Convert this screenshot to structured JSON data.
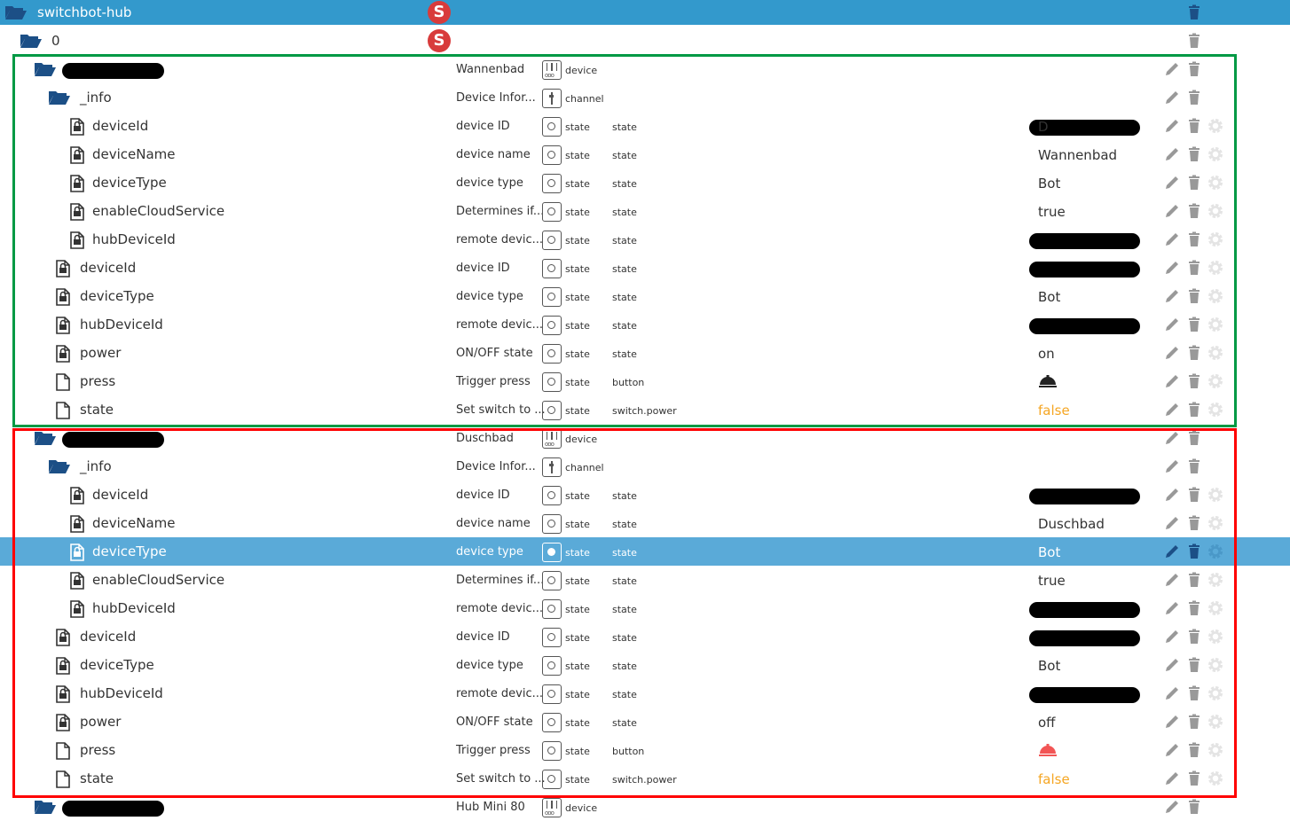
{
  "colors": {
    "header": "#3399cc",
    "selected": "#5aaad8",
    "folder": "#1c4f86",
    "false_value": "#f5a623",
    "green_box": "#009944",
    "red_box": "#ff0000",
    "bell_off": "#f25555"
  },
  "rows": [
    {
      "level": 0,
      "icon": "folder-open-icon",
      "name": "switchbot-hub",
      "header": true,
      "badge": "S",
      "actions": [
        "trash"
      ]
    },
    {
      "level": 1,
      "icon": "folder-open-icon",
      "name": "0",
      "badge": "S",
      "actions": [
        "trash"
      ]
    },
    {
      "level": 2,
      "icon": "folder-open-icon",
      "redacted": true,
      "desc": "Wannenbad",
      "typeIcon": "device-icon",
      "type": "device",
      "actions": [
        "edit",
        "trash"
      ]
    },
    {
      "level": 3,
      "icon": "folder-open-icon",
      "name": "_info",
      "desc": "Device Infor...",
      "typeIcon": "channel-icon",
      "type": "channel",
      "actions": [
        "edit",
        "trash"
      ]
    },
    {
      "level": 4,
      "icon": "file-lock-icon",
      "name": "deviceId",
      "desc": "device ID",
      "typeIcon": "state-icon",
      "type": "state",
      "role": "state",
      "value": "D",
      "valueRedacted": true,
      "actions": [
        "edit",
        "trash",
        "gear"
      ]
    },
    {
      "level": 4,
      "icon": "file-lock-icon",
      "name": "deviceName",
      "desc": "device name",
      "typeIcon": "state-icon",
      "type": "state",
      "role": "state",
      "value": "Wannenbad",
      "actions": [
        "edit",
        "trash",
        "gear"
      ]
    },
    {
      "level": 4,
      "icon": "file-lock-icon",
      "name": "deviceType",
      "desc": "device type",
      "typeIcon": "state-icon",
      "type": "state",
      "role": "state",
      "value": "Bot",
      "actions": [
        "edit",
        "trash",
        "gear"
      ]
    },
    {
      "level": 4,
      "icon": "file-lock-icon",
      "name": "enableCloudService",
      "desc": "Determines if...",
      "typeIcon": "state-icon",
      "type": "state",
      "role": "state",
      "value": "true",
      "actions": [
        "edit",
        "trash",
        "gear"
      ]
    },
    {
      "level": 4,
      "icon": "file-lock-icon",
      "name": "hubDeviceId",
      "desc": "remote devic...",
      "typeIcon": "state-icon",
      "type": "state",
      "role": "state",
      "valueRedacted": true,
      "actions": [
        "edit",
        "trash",
        "gear"
      ]
    },
    {
      "level": 3,
      "icon": "file-lock-icon",
      "name": "deviceId",
      "desc": "device ID",
      "typeIcon": "state-icon",
      "type": "state",
      "role": "state",
      "valueRedacted": true,
      "actions": [
        "edit",
        "trash",
        "gear"
      ]
    },
    {
      "level": 3,
      "icon": "file-lock-icon",
      "name": "deviceType",
      "desc": "device type",
      "typeIcon": "state-icon",
      "type": "state",
      "role": "state",
      "value": "Bot",
      "actions": [
        "edit",
        "trash",
        "gear"
      ]
    },
    {
      "level": 3,
      "icon": "file-lock-icon",
      "name": "hubDeviceId",
      "desc": "remote devic...",
      "typeIcon": "state-icon",
      "type": "state",
      "role": "state",
      "valueRedacted": true,
      "actions": [
        "edit",
        "trash",
        "gear"
      ]
    },
    {
      "level": 3,
      "icon": "file-lock-icon",
      "name": "power",
      "desc": "ON/OFF state",
      "typeIcon": "state-icon",
      "type": "state",
      "role": "state",
      "value": "on",
      "actions": [
        "edit",
        "trash",
        "gear"
      ]
    },
    {
      "level": 3,
      "icon": "file-icon",
      "name": "press",
      "desc": "Trigger press",
      "typeIcon": "state-icon",
      "type": "state",
      "role": "button",
      "valueIcon": "bell-icon",
      "actions": [
        "edit",
        "trash",
        "gear"
      ]
    },
    {
      "level": 3,
      "icon": "file-icon",
      "name": "state",
      "desc": "Set switch to ...",
      "typeIcon": "state-icon",
      "type": "state",
      "role": "switch.power",
      "value": "false",
      "valueFalse": true,
      "actions": [
        "edit",
        "trash",
        "gear"
      ]
    },
    {
      "level": 2,
      "icon": "folder-open-icon",
      "redacted": true,
      "desc": "Duschbad",
      "typeIcon": "device-icon",
      "type": "device",
      "actions": [
        "edit",
        "trash"
      ]
    },
    {
      "level": 3,
      "icon": "folder-open-icon",
      "name": "_info",
      "desc": "Device Infor...",
      "typeIcon": "channel-icon",
      "type": "channel",
      "actions": [
        "edit",
        "trash"
      ]
    },
    {
      "level": 4,
      "icon": "file-lock-icon",
      "name": "deviceId",
      "desc": "device ID",
      "typeIcon": "state-icon",
      "type": "state",
      "role": "state",
      "valueRedacted": true,
      "actions": [
        "edit",
        "trash",
        "gear"
      ]
    },
    {
      "level": 4,
      "icon": "file-lock-icon",
      "name": "deviceName",
      "desc": "device name",
      "typeIcon": "state-icon",
      "type": "state",
      "role": "state",
      "value": "Duschbad",
      "actions": [
        "edit",
        "trash",
        "gear"
      ]
    },
    {
      "level": 4,
      "icon": "file-lock-icon",
      "name": "deviceType",
      "desc": "device type",
      "typeIcon": "state-icon",
      "type": "state",
      "role": "state",
      "value": "Bot",
      "selected": true,
      "actions": [
        "edit",
        "trash",
        "gear"
      ]
    },
    {
      "level": 4,
      "icon": "file-lock-icon",
      "name": "enableCloudService",
      "desc": "Determines if...",
      "typeIcon": "state-icon",
      "type": "state",
      "role": "state",
      "value": "true",
      "actions": [
        "edit",
        "trash",
        "gear"
      ]
    },
    {
      "level": 4,
      "icon": "file-lock-icon",
      "name": "hubDeviceId",
      "desc": "remote devic...",
      "typeIcon": "state-icon",
      "type": "state",
      "role": "state",
      "valueRedacted": true,
      "actions": [
        "edit",
        "trash",
        "gear"
      ]
    },
    {
      "level": 3,
      "icon": "file-lock-icon",
      "name": "deviceId",
      "desc": "device ID",
      "typeIcon": "state-icon",
      "type": "state",
      "role": "state",
      "valueRedacted": true,
      "actions": [
        "edit",
        "trash",
        "gear"
      ]
    },
    {
      "level": 3,
      "icon": "file-lock-icon",
      "name": "deviceType",
      "desc": "device type",
      "typeIcon": "state-icon",
      "type": "state",
      "role": "state",
      "value": "Bot",
      "actions": [
        "edit",
        "trash",
        "gear"
      ]
    },
    {
      "level": 3,
      "icon": "file-lock-icon",
      "name": "hubDeviceId",
      "desc": "remote devic...",
      "typeIcon": "state-icon",
      "type": "state",
      "role": "state",
      "valueRedacted": true,
      "actions": [
        "edit",
        "trash",
        "gear"
      ]
    },
    {
      "level": 3,
      "icon": "file-lock-icon",
      "name": "power",
      "desc": "ON/OFF state",
      "typeIcon": "state-icon",
      "type": "state",
      "role": "state",
      "value": "off",
      "actions": [
        "edit",
        "trash",
        "gear"
      ]
    },
    {
      "level": 3,
      "icon": "file-icon",
      "name": "press",
      "desc": "Trigger press",
      "typeIcon": "state-icon",
      "type": "state",
      "role": "button",
      "valueIcon": "bell-red-icon",
      "actions": [
        "edit",
        "trash",
        "gear"
      ]
    },
    {
      "level": 3,
      "icon": "file-icon",
      "name": "state",
      "desc": "Set switch to ...",
      "typeIcon": "state-icon",
      "type": "state",
      "role": "switch.power",
      "value": "false",
      "valueFalse": true,
      "actions": [
        "edit",
        "trash",
        "gear"
      ]
    },
    {
      "level": 2,
      "icon": "folder-closed-icon",
      "redacted": true,
      "desc": "Hub Mini 80",
      "typeIcon": "device-icon",
      "type": "device",
      "actions": [
        "edit",
        "trash"
      ]
    }
  ]
}
